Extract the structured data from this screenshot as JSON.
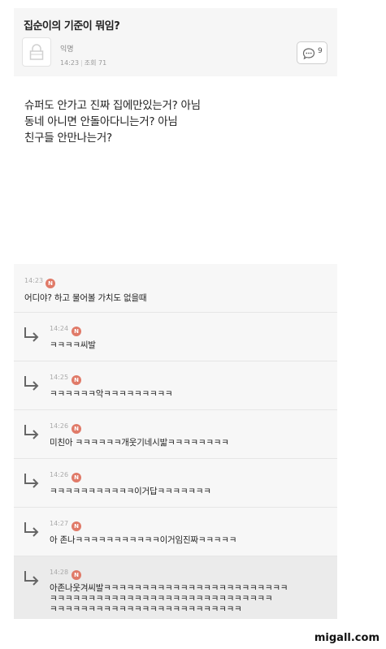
{
  "post": {
    "title": "집순이의 기준이 뭐임?",
    "author": "익명",
    "time": "14:23",
    "views": "조회 71",
    "comment_count": "9",
    "body_lines": [
      "슈퍼도 안가고 진짜 집에만있는거? 아님",
      "동네 아니면 안돌아다니는거? 아님",
      "친구들 안만나는거?"
    ]
  },
  "comments": [
    {
      "time": "14:23",
      "badge": "N",
      "text": "어디야? 하고 물어볼 가치도 없을때",
      "reply": false
    },
    {
      "time": "14:24",
      "badge": "N",
      "text": "ㅋㅋㅋㅋ씨발",
      "reply": true
    },
    {
      "time": "14:25",
      "badge": "N",
      "text": "ㅋㅋㅋㅋㅋㅋ악ㅋㅋㅋㅋㅋㅋㅋㅋㅋ",
      "reply": true
    },
    {
      "time": "14:26",
      "badge": "N",
      "text": "미친아 ㅋㅋㅋㅋㅋㅋ개웃기네시밟ㅋㅋㅋㅋㅋㅋㅋㅋ",
      "reply": true
    },
    {
      "time": "14:26",
      "badge": "N",
      "text": "ㅋㅋㅋㅋㅋㅋㅋㅋㅋㅋㅋ이거답ㅋㅋㅋㅋㅋㅋㅋ",
      "reply": true
    },
    {
      "time": "14:27",
      "badge": "N",
      "text": "아 존나ㅋㅋㅋㅋㅋㅋㅋㅋㅋㅋㅋ이거임진짜ㅋㅋㅋㅋㅋ",
      "reply": true
    },
    {
      "time": "14:28",
      "badge": "N",
      "text_lines": [
        "아존나웃겨씨발ㅋㅋㅋㅋㅋㅋㅋㅋㅋㅋㅋㅋㅋㅋㅋㅋㅋㅋㅋㅋㅋㅋㅋㅋ",
        "ㅋㅋㅋㅋㅋㅋㅋㅋㅋㅋㅋㅋㅋㅋㅋㅋㅋㅋㅋㅋㅋㅋㅋㅋㅋㅋㅋㅋㅋ",
        "ㅋㅋㅋㅋㅋㅋㅋㅋㅋㅋㅋㅋㅋㅋㅋㅋㅋㅋㅋㅋㅋㅋㅋㅋㅋ"
      ],
      "reply": true
    }
  ],
  "watermark": "migall.com",
  "colors": {
    "badge": "#e07a68",
    "header_bg": "#f6f6f6",
    "comment_bg": "#f7f7f7",
    "highlight_bg": "#ebebeb"
  }
}
